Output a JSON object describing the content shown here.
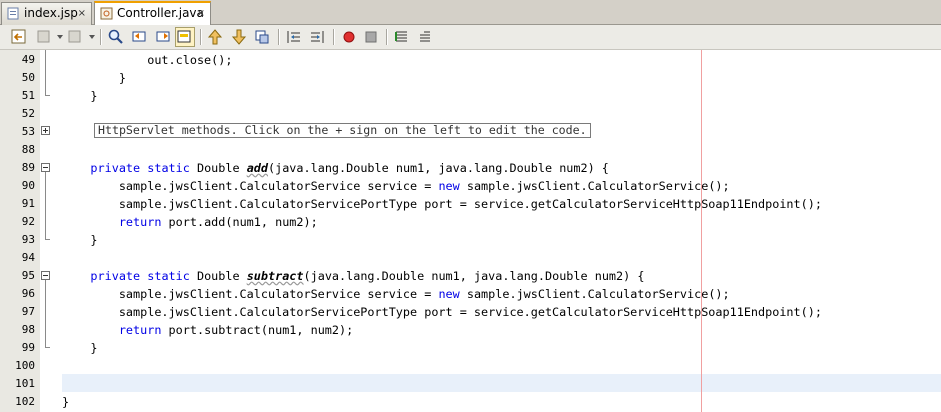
{
  "tabs": [
    {
      "label": "index.jsp",
      "active": false,
      "icon": "jsp-file-icon"
    },
    {
      "label": "Controller.java",
      "active": true,
      "icon": "java-file-icon"
    }
  ],
  "close_glyph": "×",
  "toolbar": {
    "buttons": [
      "back-to-last-edit",
      "previous",
      "next",
      "find-selection",
      "find-previous",
      "find-next",
      "toggle-highlight-search",
      "previous-bookmark",
      "next-bookmark",
      "toggle-bookmark",
      "shift-line-left",
      "shift-line-right",
      "start-macro-recording",
      "stop-macro-recording",
      "comment",
      "uncomment"
    ]
  },
  "editor": {
    "collapsed_fold_text": "HttpServlet methods. Click on the + sign on the left to edit the code.",
    "lines": [
      {
        "num": "49",
        "code": "            out.close();"
      },
      {
        "num": "50",
        "code": "        }"
      },
      {
        "num": "51",
        "code": "    }"
      },
      {
        "num": "52",
        "code": ""
      },
      {
        "num": "53",
        "code": ""
      },
      {
        "num": "88",
        "code": ""
      },
      {
        "num": "89",
        "code_pre": "    ",
        "kw1": "private static",
        "mid1": " Double ",
        "method": "add",
        "code_post": "(java.lang.Double num1, java.lang.Double num2) {"
      },
      {
        "num": "90",
        "code_pre": "        sample.jwsClient.CalculatorService service = ",
        "kw1": "new",
        "code_post": " sample.jwsClient.CalculatorService();"
      },
      {
        "num": "91",
        "code": "        sample.jwsClient.CalculatorServicePortType port = service.getCalculatorServiceHttpSoap11Endpoint();"
      },
      {
        "num": "92",
        "code_pre": "        ",
        "kw1": "return",
        "code_post": " port.add(num1, num2);"
      },
      {
        "num": "93",
        "code": "    }"
      },
      {
        "num": "94",
        "code": ""
      },
      {
        "num": "95",
        "code_pre": "    ",
        "kw1": "private static",
        "mid1": " Double ",
        "method": "subtract",
        "code_post": "(java.lang.Double num1, java.lang.Double num2) {"
      },
      {
        "num": "96",
        "code_pre": "        sample.jwsClient.CalculatorService service = ",
        "kw1": "new",
        "code_post": " sample.jwsClient.CalculatorService();"
      },
      {
        "num": "97",
        "code": "        sample.jwsClient.CalculatorServicePortType port = service.getCalculatorServiceHttpSoap11Endpoint();"
      },
      {
        "num": "98",
        "code_pre": "        ",
        "kw1": "return",
        "code_post": " port.subtract(num1, num2);"
      },
      {
        "num": "99",
        "code": "    }"
      },
      {
        "num": "100",
        "code": ""
      },
      {
        "num": "101",
        "code": ""
      },
      {
        "num": "102",
        "code": "}"
      }
    ]
  },
  "colors": {
    "keyword": "#0000e6",
    "right_margin": "#f0a0a0",
    "current_line": "#e8f0fa",
    "active_tab_accent": "#f0a000"
  }
}
